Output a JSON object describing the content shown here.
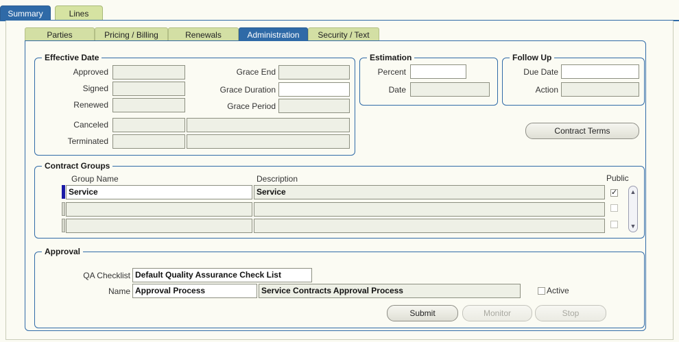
{
  "top_tabs": [
    {
      "label": "Summary"
    },
    {
      "label": "Lines"
    }
  ],
  "sub_tabs": [
    {
      "label": "Parties"
    },
    {
      "label": "Pricing / Billing"
    },
    {
      "label": "Renewals"
    },
    {
      "label": "Administration"
    },
    {
      "label": "Security / Text"
    }
  ],
  "effective_date": {
    "title": "Effective Date",
    "approved_label": "Approved",
    "signed_label": "Signed",
    "renewed_label": "Renewed",
    "canceled_label": "Canceled",
    "terminated_label": "Terminated",
    "grace_end_label": "Grace End",
    "grace_duration_label": "Grace Duration",
    "grace_period_label": "Grace Period"
  },
  "estimation": {
    "title": "Estimation",
    "percent_label": "Percent",
    "date_label": "Date"
  },
  "follow_up": {
    "title": "Follow Up",
    "due_date_label": "Due Date",
    "action_label": "Action"
  },
  "contract_terms_label": "Contract Terms",
  "contract_groups": {
    "title": "Contract Groups",
    "col_group_name": "Group Name",
    "col_description": "Description",
    "col_public": "Public",
    "rows": [
      {
        "group_name": "Service",
        "description": "Service",
        "public": true
      },
      {
        "group_name": "",
        "description": "",
        "public": false
      },
      {
        "group_name": "",
        "description": "",
        "public": false
      }
    ]
  },
  "approval": {
    "title": "Approval",
    "qa_checklist_label": "QA Checklist",
    "qa_checklist_value": "Default Quality Assurance Check List",
    "name_label": "Name",
    "name_value": "Approval Process",
    "name_description": "Service Contracts Approval Process",
    "active_label": "Active",
    "submit_label": "Submit",
    "monitor_label": "Monitor",
    "stop_label": "Stop"
  },
  "colors": {
    "accent": "#2f6aa7",
    "tab_inactive": "#d3dfa4",
    "background": "#fbfbf3",
    "row_marker": "#1a1aa6"
  }
}
